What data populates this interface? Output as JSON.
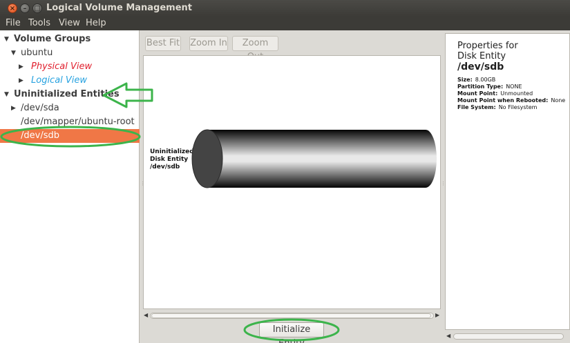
{
  "window": {
    "title": "Logical Volume Management"
  },
  "menu": [
    "File",
    "Tools",
    "View",
    "Help"
  ],
  "tree": {
    "volume_groups": "Volume Groups",
    "vg_name": "ubuntu",
    "physical_view": "Physical View",
    "logical_view": "Logical View",
    "uninitialized": "Uninitialized Entities",
    "entities": [
      "/dev/sda",
      "/dev/mapper/ubuntu-root",
      "/dev/sdb"
    ]
  },
  "toolbar": {
    "best_fit": "Best Fit",
    "zoom_in": "Zoom In",
    "zoom_out": "Zoom Out"
  },
  "diagram": {
    "label_line1": "Uninitialized",
    "label_line2": "Disk Entity",
    "label_line3": "/dev/sdb"
  },
  "action": {
    "initialize": "Initialize Entity"
  },
  "properties": {
    "title_line1": "Properties for",
    "title_line2": "Disk Entity",
    "device": "/dev/sdb",
    "rows": [
      {
        "key": "Size:",
        "value": "8.00GB"
      },
      {
        "key": "Partition Type:",
        "value": "NONE"
      },
      {
        "key": "Mount Point:",
        "value": "Unmounted"
      },
      {
        "key": "Mount Point when Rebooted:",
        "value": "None"
      },
      {
        "key": "File System:",
        "value": "No Filesystem"
      }
    ]
  },
  "colors": {
    "selection": "#f07746",
    "annotation": "#3cb44b",
    "physical": "#e0202e",
    "logical": "#27a2e0"
  }
}
